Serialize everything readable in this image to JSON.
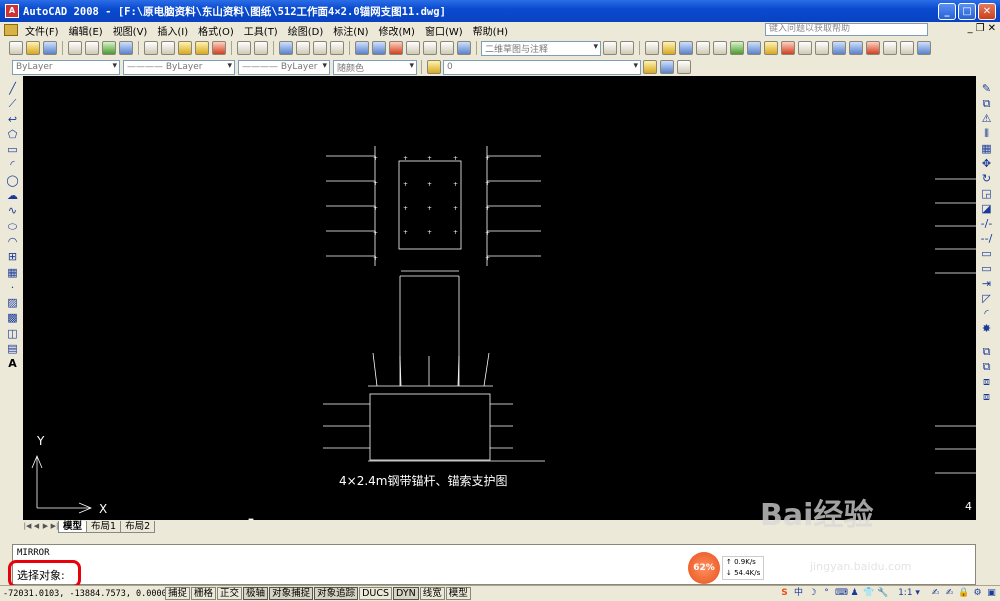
{
  "window": {
    "title": "AutoCAD 2008 - [F:\\原电脑资料\\东山资料\\图纸\\512工作面4×2.0锚网支图11.dwg]",
    "icon": "autocad-app-icon"
  },
  "menu": {
    "items": [
      "文件(F)",
      "编辑(E)",
      "视图(V)",
      "插入(I)",
      "格式(O)",
      "工具(T)",
      "绘图(D)",
      "标注(N)",
      "修改(M)",
      "窗口(W)",
      "帮助(H)"
    ],
    "help_placeholder": "键入问题以获取帮助"
  },
  "toolbars": {
    "workspace": "二维草图与注释",
    "layer_combo": "ByLayer",
    "linetype_combo": "———— ByLayer",
    "lineweight_combo": "———— ByLayer",
    "color_combo": "随颜色",
    "layer_state": "0"
  },
  "drawing": {
    "caption": "4×2.4m钢带锚杆、锚索支护图",
    "ucs_x": "X",
    "ucs_y": "Y",
    "corner_number": "4"
  },
  "layout_tabs": [
    "模型",
    "布局1",
    "布局2"
  ],
  "command": {
    "line1": "MIRROR",
    "prompt": "选择对象:"
  },
  "status": {
    "coords": "-72031.0103, -13884.7573, 0.0000",
    "buttons": [
      "捕捉",
      "栅格",
      "正交",
      "极轴",
      "对象捕捉",
      "对象追踪",
      "DUCS",
      "DYN",
      "线宽",
      "模型"
    ],
    "scale": "1:1 ▾",
    "ime": "中"
  },
  "network": {
    "percent": "62%",
    "up": "0.9K/s",
    "down": "54.4K/s"
  },
  "watermark": {
    "logo": "Bai经验",
    "url": "jingyan.baidu.com"
  }
}
